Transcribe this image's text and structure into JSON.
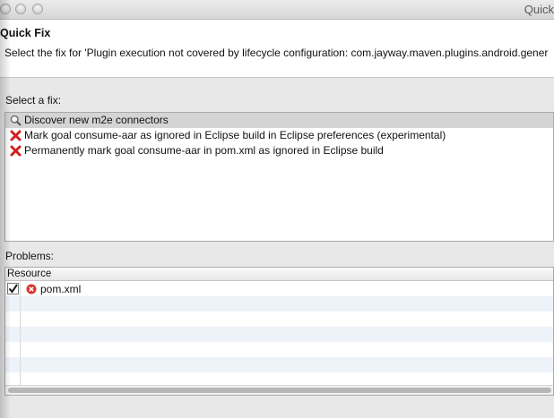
{
  "window": {
    "title": "Quick"
  },
  "header": {
    "title": "Quick Fix",
    "description": "Select the fix for 'Plugin execution not covered by lifecycle configuration: com.jayway.maven.plugins.android.gener"
  },
  "fixes": {
    "label": "Select a fix:",
    "items": [
      {
        "label": "Discover new m2e connectors",
        "icon": "magnifier-icon"
      },
      {
        "label": "Mark goal consume-aar as ignored in Eclipse build in Eclipse preferences (experimental)",
        "icon": "red-x-icon"
      },
      {
        "label": "Permanently mark goal consume-aar in pom.xml as ignored in Eclipse build",
        "icon": "red-x-icon"
      }
    ]
  },
  "problems": {
    "label": "Problems:",
    "column_header": "Resource",
    "rows": [
      {
        "checked": true,
        "icon": "error-icon",
        "resource": "pom.xml"
      }
    ]
  },
  "colors": {
    "selection": "#d4d4d4",
    "error_red": "#d21f1f",
    "alt_row": "#eef3fa"
  }
}
